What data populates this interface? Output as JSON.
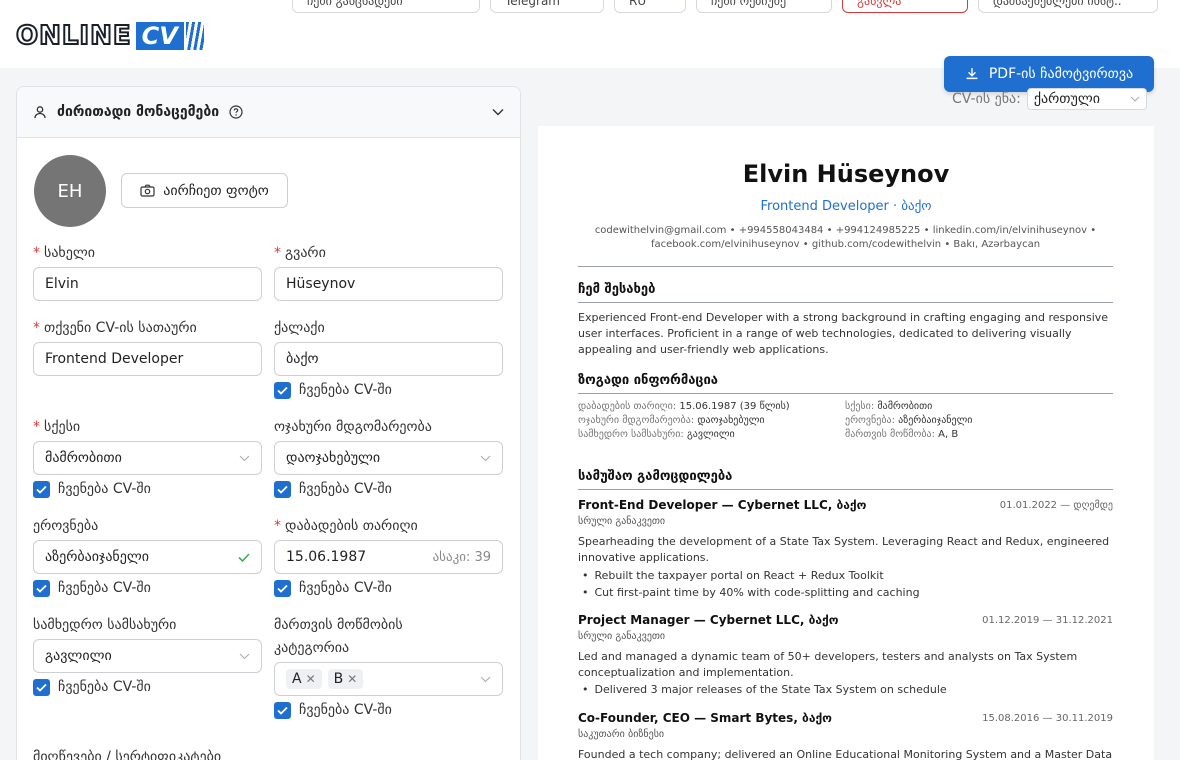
{
  "header": {
    "logo_text": "ONLINE",
    "logo_cv": "CV",
    "nav": [
      "ჩემი განცხადები",
      "Telegram",
      "RU",
      "ჩემი რეზიუმე",
      "გასვლა",
      "დამსაქმებლები ინსტ.."
    ],
    "pdf_button": "PDF-ის ჩამოტვირთვა",
    "cv_lang_label": "CV-ის ენა:",
    "cv_lang_value": "ქართული"
  },
  "form": {
    "section_title": "ძირითადი მონაცემები",
    "avatar_initials": "EH",
    "photo_button": "აირჩიეთ ფოტო",
    "show_in_cv": "ჩვენება CV-ში",
    "fields": {
      "first_name": {
        "label": "სახელი",
        "value": "Elvin"
      },
      "last_name": {
        "label": "გვარი",
        "value": "Hüseynov"
      },
      "cv_title": {
        "label": "თქვენი CV-ის სათაური",
        "value": "Frontend Developer"
      },
      "city": {
        "label": "ქალაქი",
        "value": "ბაქო"
      },
      "gender": {
        "label": "სქესი",
        "value": "მამრობითი"
      },
      "marital": {
        "label": "ოჯახური მდგომარეობა",
        "value": "დაოჯახებული"
      },
      "nationality": {
        "label": "ეროვნება",
        "value": "აზერბაიჯანელი"
      },
      "birth_date": {
        "label": "დაბადების თარიღი",
        "value": "15.06.1987",
        "age_hint": "ასაკი: 39"
      },
      "military": {
        "label": "სამხედრო სამსახური",
        "value": "გავლილი"
      },
      "license": {
        "label_line1": "მართვის მოწმობის",
        "label_line2": "კატეგორია",
        "tags": [
          "A",
          "B"
        ]
      }
    },
    "next_section": "მიღწევები / სერტიფიკატები"
  },
  "resume": {
    "name": "Elvin Hüseynov",
    "role": "Frontend Developer · ბაქო",
    "contacts_line1": [
      "codewithelvin@gmail.com",
      "+994558043484",
      "+994124985225",
      "linkedin.com/in/elvinihuseynov"
    ],
    "contacts_line2": [
      "facebook.com/elvinihuseynov",
      "github.com/codewithelvin",
      "Bakı, Azərbaycan"
    ],
    "about_heading": "ჩემ შესახებ",
    "about_text": "Experienced Front-end Developer with a strong background in crafting engaging and responsive user interfaces. Proficient in a range of web technologies, dedicated to delivering visually appealing and user-friendly web applications.",
    "general_heading": "ზოგადი ინფორმაცია",
    "general": [
      {
        "k": "დაბადების თარიღი:",
        "v": "15.06.1987 (39 წლის)"
      },
      {
        "k": "სქესი:",
        "v": "მამრობითი"
      },
      {
        "k": "ოჯახური მდგომარეობა:",
        "v": "დაოჯახებული"
      },
      {
        "k": "ეროვნება:",
        "v": "აზერბაიჯანელი"
      },
      {
        "k": "სამხედრო სამსახური:",
        "v": "გავლილი"
      },
      {
        "k": "მართვის მოწმობა:",
        "v": "A, B"
      }
    ],
    "experience_heading": "სამუშაო გამოცდილება",
    "jobs": [
      {
        "title": "Front-End Developer — Cybernet LLC, ბაქო",
        "dates": "01.01.2022 — დღემდე",
        "type": "სრული განაკვეთი",
        "desc": "Spearheading the development of a State Tax System. Leveraging React and Redux, engineered innovative applications.",
        "bullets": [
          "Rebuilt the taxpayer portal on React + Redux Toolkit",
          "Cut first-paint time by 40% with code-splitting and caching"
        ]
      },
      {
        "title": "Project Manager — Cybernet LLC, ბაქო",
        "dates": "01.12.2019 — 31.12.2021",
        "type": "სრული განაკვეთი",
        "desc": "Led and managed a dynamic team of 50+ developers, testers and analysts on Tax System conceptualization and implementation.",
        "bullets": [
          "Delivered 3 major releases of the State Tax System on schedule"
        ]
      },
      {
        "title": "Co-Founder, CEO — Smart Bytes, ბაქო",
        "dates": "15.08.2016 — 30.11.2019",
        "type": "საკუთარი ბიზნესი",
        "desc": "Founded a tech company; delivered an Online Educational Monitoring System and a Master Data"
      }
    ]
  }
}
